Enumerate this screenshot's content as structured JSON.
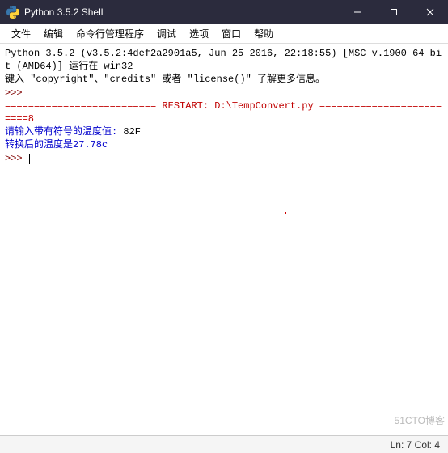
{
  "window": {
    "title": "Python 3.5.2 Shell"
  },
  "menu": {
    "items": [
      "文件",
      "编辑",
      "命令行管理程序",
      "调试",
      "选项",
      "窗口",
      "帮助"
    ]
  },
  "terminal": {
    "banner1": "Python 3.5.2 (v3.5.2:4def2a2901a5, Jun 25 2016, 22:18:55) [MSC v.1900 64 bit (AMD64)] 运行在 win32",
    "banner2": "键入 \"copyright\"、\"credits\" 或者 \"license()\" 了解更多信息。",
    "prompt": ">>> ",
    "restart_line": "========================== RESTART: D:\\TempConvert.py =========================8",
    "input_prompt": "请输入带有符号的温度值: ",
    "input_value": "82F",
    "output_line": "转换后的温度是27.78c"
  },
  "status": {
    "text": "Ln: 7  Col: 4"
  },
  "watermark": "51CTO博客"
}
